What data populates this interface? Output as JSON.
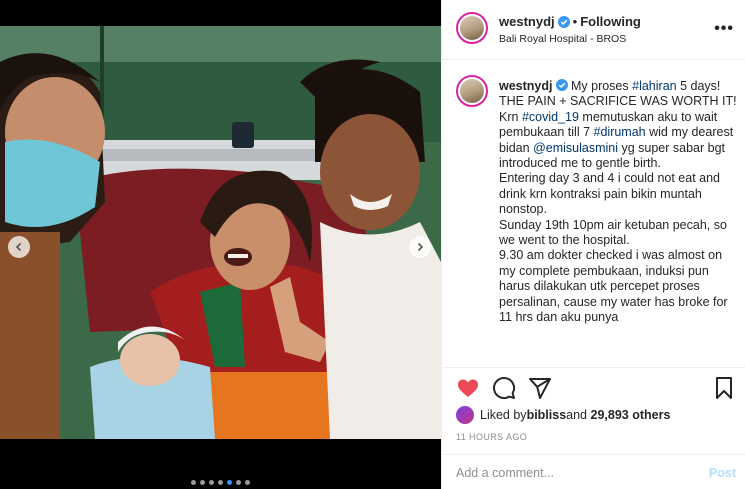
{
  "post": {
    "username": "westnydj",
    "follow_status": "Following",
    "location": "Bali Royal Hospital - BROS",
    "more_label": "•••"
  },
  "caption": {
    "username": "westnydj",
    "intro": "My proses ",
    "hashtag_lahiran": "#lahiran",
    "after_lahiran": " 5 days!",
    "line_worth": "THE PAIN + SACRIFICE WAS WORTH IT!",
    "krn": "Krn ",
    "hashtag_covid": "#covid_19",
    "after_covid": " memutuskan aku to wait pembukaan till 7 ",
    "hashtag_dirumah": "#dirumah",
    "after_dirumah": " wid my dearest bidan ",
    "mention": "@emisulasmini",
    "after_mention": " yg super sabar bgt introduced me to gentle birth.",
    "para_day3": "Entering day 3 and 4 i could not eat and drink krn kontraksi pain bikin muntah nonstop.",
    "para_sunday": "Sunday 19th 10pm air ketuban pecah, so we went to the hospital.",
    "para_doctor": "9.30 am dokter checked i was almost on my complete pembukaan, induksi pun harus dilakukan utk percepet proses persalinan, cause my water has broke for 11 hrs dan aku punya"
  },
  "likes": {
    "prefix": "Liked by ",
    "user": "bibliss",
    "middle": " and ",
    "count": "29,893 others"
  },
  "timestamp": "11 HOURS AGO",
  "comment": {
    "placeholder": "Add a comment...",
    "post_label": "Post"
  },
  "carousel": {
    "slide_count": 7,
    "active_index": 4
  },
  "icons": {
    "like": "heart-icon",
    "comment": "comment-icon",
    "share": "paper-plane-icon",
    "save": "bookmark-icon",
    "verified": "verified-badge-icon"
  },
  "colors": {
    "like_red": "#ed4956",
    "verified_blue": "#3897f0",
    "tag_blue": "#00376b",
    "post_button": "#b2dffc",
    "active_dot": "#3897f0"
  }
}
